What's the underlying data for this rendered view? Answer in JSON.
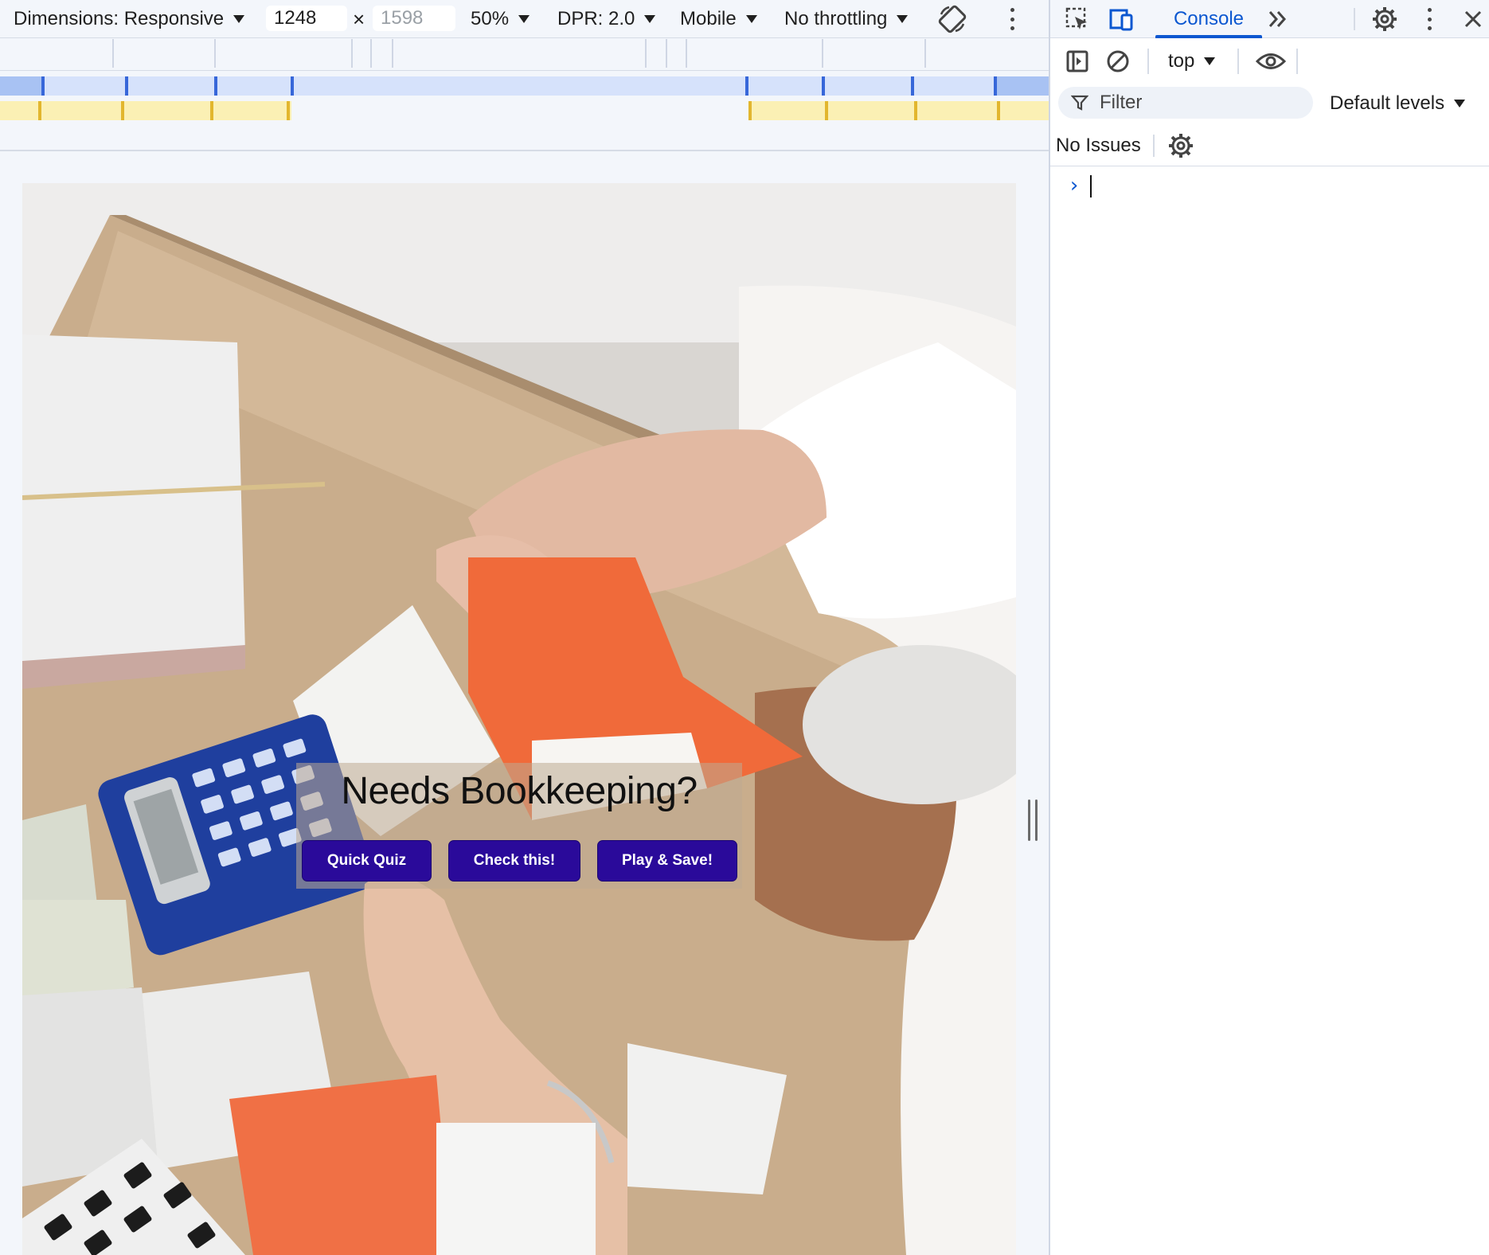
{
  "device_toolbar": {
    "dimensions_label": "Dimensions: Responsive",
    "width_value": "1248",
    "height_placeholder": "1598",
    "times_symbol": "×",
    "zoom": "50%",
    "dpr": "DPR: 2.0",
    "device_type": "Mobile",
    "throttling": "No throttling",
    "icons": [
      "rotate-icon",
      "more-vert-icon"
    ]
  },
  "page": {
    "hero_title": "Needs Bookkeeping?",
    "buttons": [
      {
        "label": "Quick Quiz"
      },
      {
        "label": "Check this!"
      },
      {
        "label": "Play & Save!"
      }
    ],
    "button_color": "#2a0a9a"
  },
  "devtools": {
    "tabs": [
      {
        "label": "Console",
        "active": true
      }
    ],
    "more_tabs_icon": "chevron-double-right-icon",
    "toolbar_icons": [
      "inspect-element-icon",
      "device-toggle-icon",
      "settings-gear-icon",
      "more-vert-icon",
      "close-icon"
    ],
    "context": "top",
    "filter_placeholder": "Filter",
    "levels": "Default levels",
    "issues": "No Issues",
    "prompt_symbol": "›",
    "accent": "#0b57d0"
  }
}
